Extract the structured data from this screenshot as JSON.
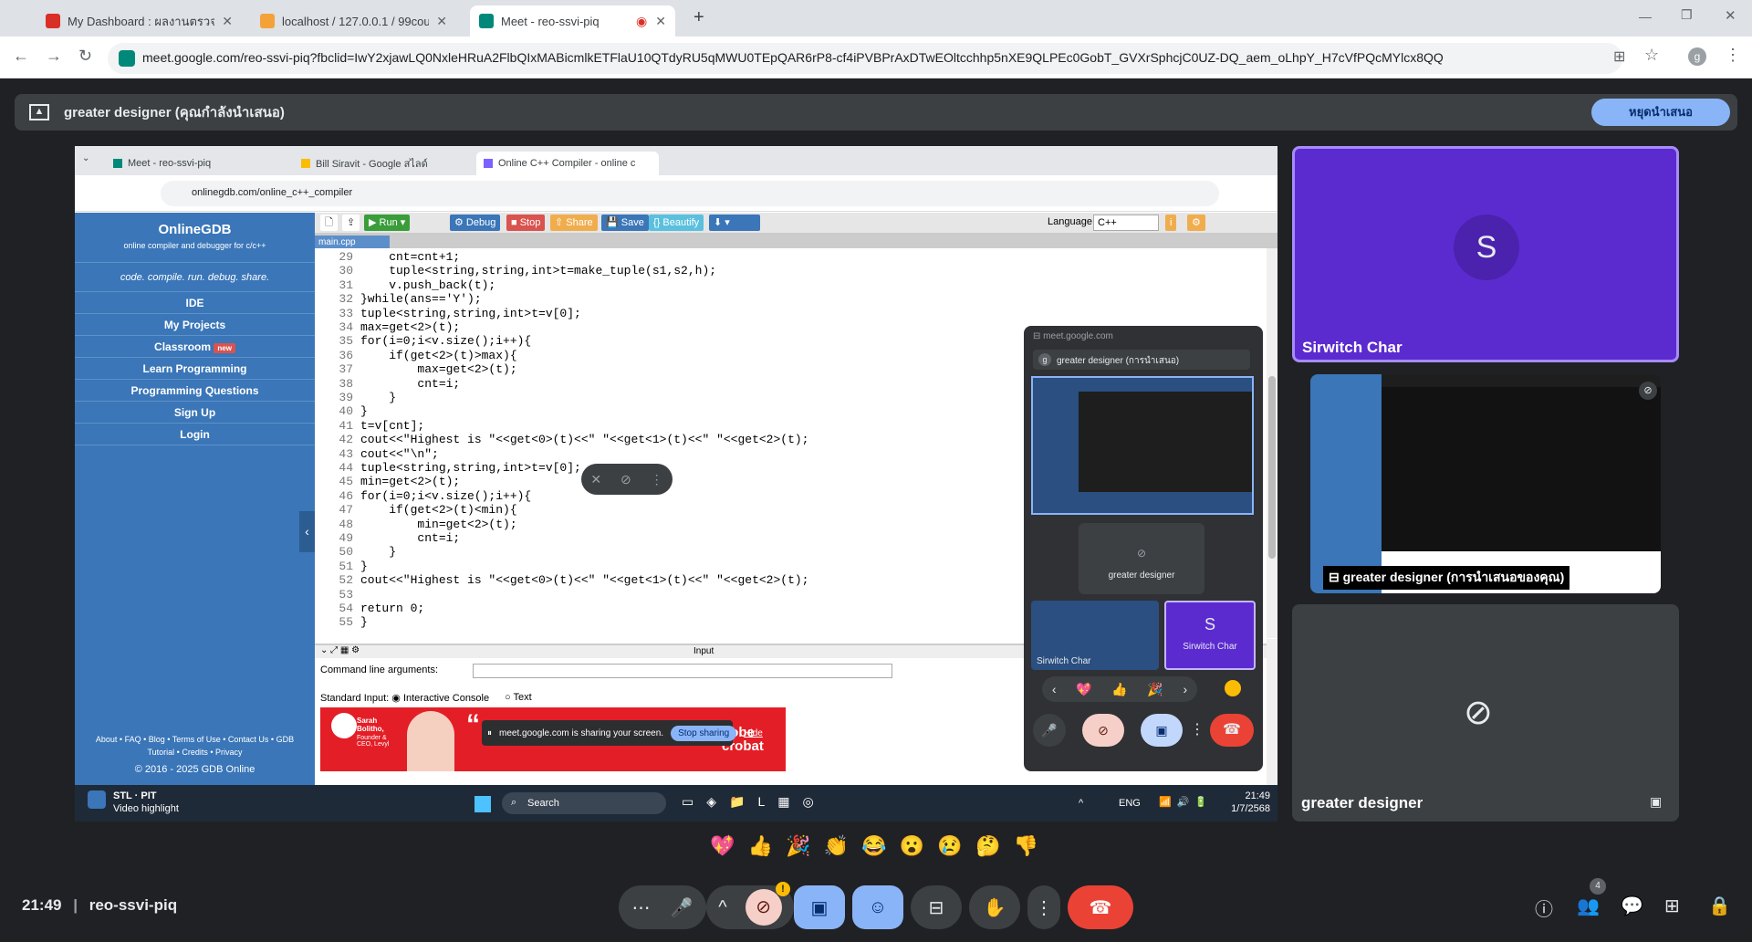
{
  "browser": {
    "tabs": [
      {
        "title": "My Dashboard : ผลงานตรวจสอบเอ็น"
      },
      {
        "title": "localhost / 127.0.0.1 / 99course"
      },
      {
        "title": "Meet - reo-ssvi-piq"
      }
    ],
    "url": "meet.google.com/reo-ssvi-piq?fbclid=IwY2xjawLQ0NxleHRuA2FlbQIxMABicmlkETFlaU10QTdyRU5qMWU0TEpQAR6rP8-cf4iPVBPrAxDTwEOltcchhp5nXE9QLPEc0GobT_GVXrSphcjC0UZ-DQ_aem_oLhpY_H7cVfPQcMYlcx8QQ",
    "profile_initial": "g"
  },
  "meet": {
    "presenter_banner": "greater designer (คุณกำลังนำเสนอ)",
    "stop_presenting": "หยุดนำเสนอ",
    "time": "21:49",
    "meeting_code": "reo-ssvi-piq",
    "participant_count": "4",
    "reactions": [
      "💖",
      "👍",
      "🎉",
      "👏",
      "😂",
      "😮",
      "😢",
      "🤔",
      "👎"
    ],
    "tiles": [
      {
        "name": "Sirwitch Char",
        "initial": "S"
      },
      {
        "name": "greater designer (การนำเสนอของคุณ)"
      },
      {
        "name": "greater designer"
      }
    ]
  },
  "shared": {
    "tabs": [
      "Meet - reo-ssvi-piq",
      "Bill Siravit - Google สไลด์",
      "Online C++ Compiler - online c"
    ],
    "url": "onlinegdb.com/online_c++_compiler",
    "brand": "OnlineGDB",
    "brand_sub": "online compiler and debugger for c/c++",
    "tagline": "code. compile. run. debug. share.",
    "menu": [
      "IDE",
      "My Projects",
      "Classroom",
      "Learn Programming",
      "Programming Questions",
      "Sign Up",
      "Login"
    ],
    "classroom_badge": "new",
    "footer_links": "About • FAQ • Blog • Terms of Use • Contact Us • GDB Tutorial • Credits • Privacy",
    "copyright": "© 2016 - 2025 GDB Online",
    "toolbar": {
      "run": "Run",
      "debug": "Debug",
      "stop": "Stop",
      "share": "Share",
      "save": "Save",
      "beautify": "{} Beautify",
      "language_label": "Language",
      "language": "C++"
    },
    "file_tab": "main.cpp",
    "code_lines": [
      {
        "n": "29",
        "t": "    cnt=cnt+1;"
      },
      {
        "n": "30",
        "t": "    tuple<string,string,int>t=make_tuple(s1,s2,h);"
      },
      {
        "n": "31",
        "t": "    v.push_back(t);"
      },
      {
        "n": "32",
        "t": "}while(ans=='Y');"
      },
      {
        "n": "33",
        "t": "tuple<string,string,int>t=v[0];"
      },
      {
        "n": "34",
        "t": "max=get<2>(t);"
      },
      {
        "n": "35",
        "t": "for(i=0;i<v.size();i++){"
      },
      {
        "n": "36",
        "t": "    if(get<2>(t)>max){"
      },
      {
        "n": "37",
        "t": "        max=get<2>(t);"
      },
      {
        "n": "38",
        "t": "        cnt=i;"
      },
      {
        "n": "39",
        "t": "    }"
      },
      {
        "n": "40",
        "t": "}"
      },
      {
        "n": "41",
        "t": "t=v[cnt];"
      },
      {
        "n": "42",
        "t": "cout<<\"Highest is \"<<get<0>(t)<<\" \"<<get<1>(t)<<\" \"<<get<2>(t);"
      },
      {
        "n": "43",
        "t": "cout<<\"\\n\";"
      },
      {
        "n": "44",
        "t": "tuple<string,string,int>t=v[0];"
      },
      {
        "n": "45",
        "t": "min=get<2>(t);"
      },
      {
        "n": "46",
        "t": "for(i=0;i<v.size();i++){"
      },
      {
        "n": "47",
        "t": "    if(get<2>(t)<min){"
      },
      {
        "n": "48",
        "t": "        min=get<2>(t);"
      },
      {
        "n": "49",
        "t": "        cnt=i;"
      },
      {
        "n": "50",
        "t": "    }"
      },
      {
        "n": "51",
        "t": "}"
      },
      {
        "n": "52",
        "t": "cout<<\"Highest is \"<<get<0>(t)<<\" \"<<get<1>(t)<<\" \"<<get<2>(t);"
      },
      {
        "n": "53",
        "t": ""
      },
      {
        "n": "54",
        "t": "return 0;"
      },
      {
        "n": "55",
        "t": "}"
      }
    ],
    "input_header": "Input",
    "cmd_args": "Command line arguments:",
    "stdin_label": "Standard Input:",
    "interactive": "Interactive Console",
    "text_opt": "Text",
    "ad_name": "Sarah Bolitho,",
    "ad_role": "Founder & CEO, Levyl",
    "ad_text": "dobe crobat",
    "sharing_msg": "meet.google.com is sharing your screen.",
    "stop_sharing": "Stop sharing",
    "hide": "Hide",
    "taskbar": {
      "weather": "STL · PIT",
      "weather_sub": "Video highlight",
      "search": "Search",
      "lang": "ENG",
      "time": "21:49",
      "date": "1/7/2568"
    },
    "panel": {
      "url": "meet.google.com",
      "presenter": "greater designer (การนำเสนอ)",
      "tile_name": "greater designer",
      "small1": "Sirwitch Char",
      "small2": "Sirwitch Char",
      "avatar": "S"
    }
  }
}
